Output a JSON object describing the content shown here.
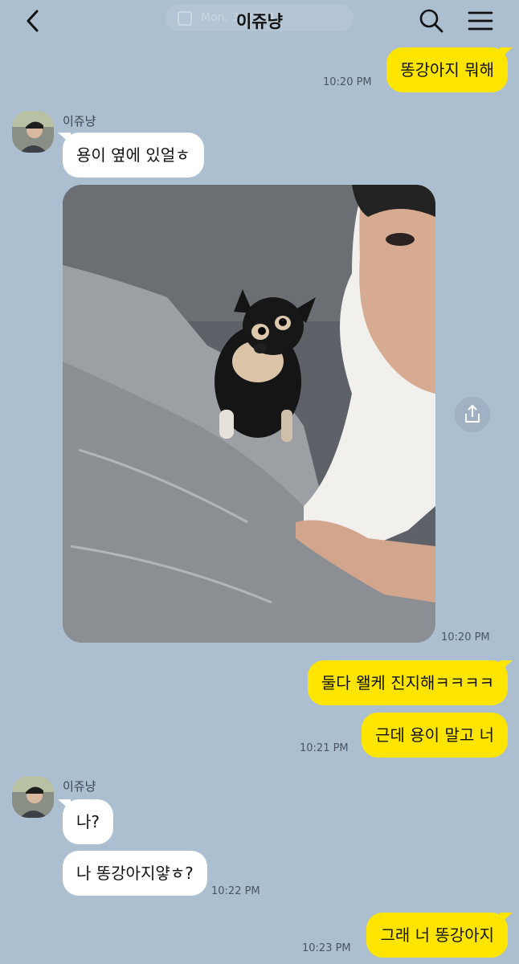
{
  "header": {
    "title": "이쥬냥",
    "date_ghost": "Mon, 3, 2024"
  },
  "icons": {
    "back": "chevron-left-icon",
    "search": "search-icon",
    "menu": "hamburger-menu-icon",
    "share": "share-icon"
  },
  "colors": {
    "background": "#abbfd0",
    "my_bubble": "#fee500",
    "other_bubble": "#ffffff"
  },
  "messages": {
    "m1": {
      "text": "똥강아지 뭐해",
      "time": "10:20 PM"
    },
    "g1": {
      "sender": "이쥬냥",
      "text": "용이 옆에 있얼ㅎ",
      "photo_time": "10:20 PM"
    },
    "m2": {
      "text": "둘다 왤케 진지해ㅋㅋㅋㅋ"
    },
    "m3": {
      "text": "근데 용이 말고 너",
      "time": "10:21 PM"
    },
    "g2": {
      "sender": "이쥬냥",
      "text1": "나?",
      "text2": "나 똥강아지얗ㅎ?",
      "time": "10:22 PM"
    },
    "m4": {
      "text": "그래 너 똥강아지",
      "time": "10:23 PM"
    }
  }
}
